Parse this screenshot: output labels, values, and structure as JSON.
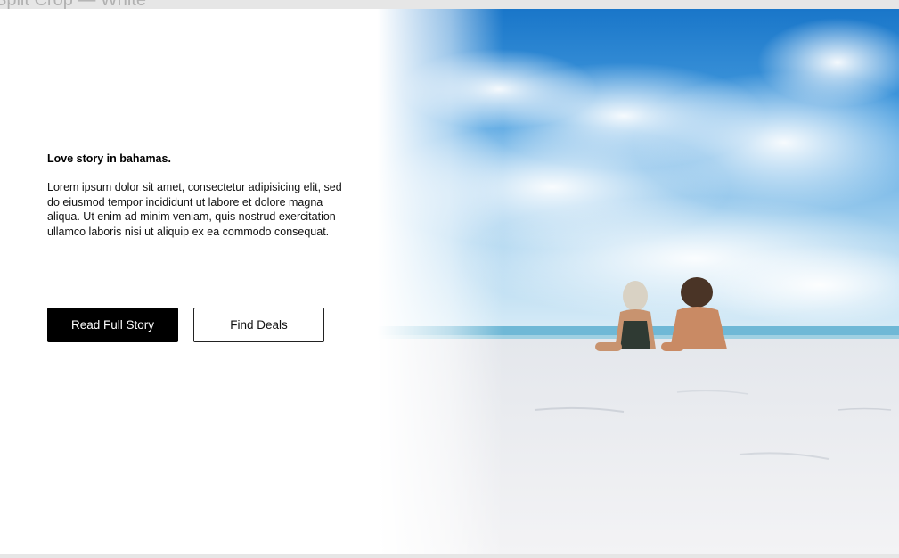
{
  "frame": {
    "label": "Split Crop — White"
  },
  "hero": {
    "image_description": "beach-couple-photo",
    "title": "Love story in bahamas.",
    "body": "Lorem ipsum dolor sit amet, consectetur adipisicing elit, sed do eiusmod tempor incididunt ut labore et dolore magna aliqua. Ut enim ad minim veniam, quis nostrud exercitation ullamco laboris nisi ut aliquip ex ea commodo consequat."
  },
  "buttons": {
    "primary_label": "Read Full Story",
    "secondary_label": "Find Deals"
  },
  "colors": {
    "sky_top": "#1f7fd1",
    "sky_mid": "#6fb4e8",
    "sea": "#4aa9c9",
    "sand": "#eef0f3",
    "primary_button_bg": "#000000"
  }
}
